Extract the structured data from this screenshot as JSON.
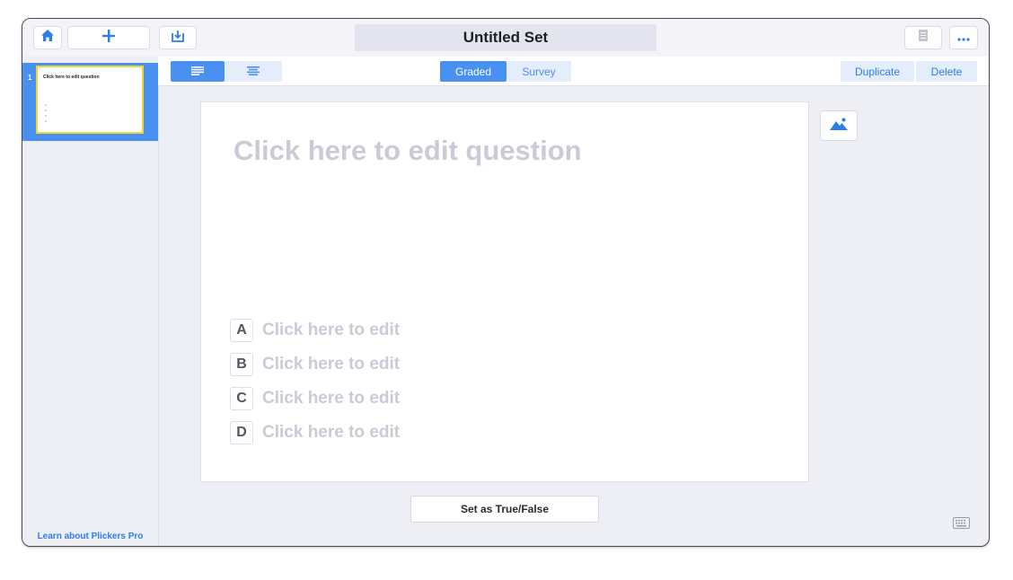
{
  "header": {
    "title": "Untitled Set",
    "icons": [
      "home-icon",
      "plus-icon",
      "import-icon",
      "document-icon",
      "more-icon"
    ],
    "accent": "#2d7ee8"
  },
  "sidebar": {
    "slides": [
      {
        "number": "1",
        "question": "Click here to edit question",
        "options": [
          "A",
          "B",
          "C",
          "D"
        ]
      }
    ],
    "learn_link": "Learn about Plickers Pro",
    "selected_color": "#4a90f0",
    "thumb_border_color": "#f5d52a"
  },
  "toolbar": {
    "layout_icons": [
      "layout-left-align-icon",
      "layout-center-align-icon"
    ],
    "mode_tabs": [
      {
        "label": "Graded",
        "active": true
      },
      {
        "label": "Survey",
        "active": false
      }
    ],
    "duplicate_label": "Duplicate",
    "delete_label": "Delete"
  },
  "editor": {
    "question_placeholder": "Click here to edit question",
    "choices": [
      {
        "letter": "A",
        "text": "Click here to edit"
      },
      {
        "letter": "B",
        "text": "Click here to edit"
      },
      {
        "letter": "C",
        "text": "Click here to edit"
      },
      {
        "letter": "D",
        "text": "Click here to edit"
      }
    ],
    "set_true_false_label": "Set as True/False",
    "icons": [
      "image-icon",
      "keyboard-icon"
    ]
  }
}
